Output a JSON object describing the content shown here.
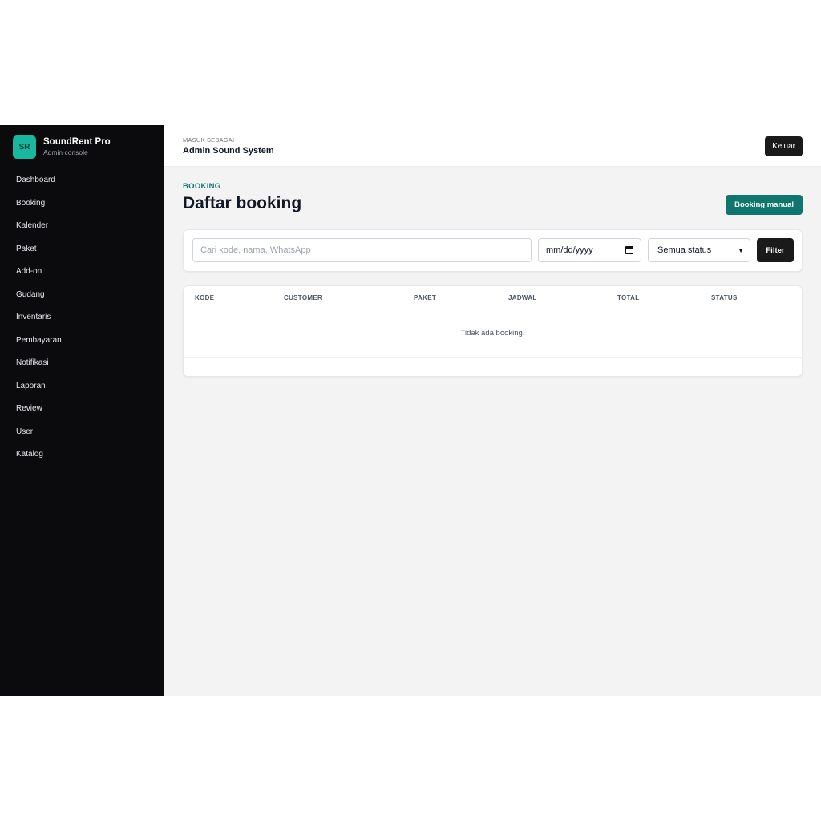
{
  "sidebar": {
    "logo_text": "SR",
    "brand_name": "SoundRent Pro",
    "brand_sub": "Admin console",
    "items": [
      {
        "label": "Dashboard"
      },
      {
        "label": "Booking"
      },
      {
        "label": "Kalender"
      },
      {
        "label": "Paket"
      },
      {
        "label": "Add-on"
      },
      {
        "label": "Gudang"
      },
      {
        "label": "Inventaris"
      },
      {
        "label": "Pembayaran"
      },
      {
        "label": "Notifikasi"
      },
      {
        "label": "Laporan"
      },
      {
        "label": "Review"
      },
      {
        "label": "User"
      },
      {
        "label": "Katalog"
      }
    ]
  },
  "header": {
    "signin_label": "MASUK SEBAGAI",
    "user_name": "Admin Sound System",
    "logout_label": "Keluar"
  },
  "page": {
    "section": "BOOKING",
    "title": "Daftar booking",
    "manual_button": "Booking manual"
  },
  "filters": {
    "search_placeholder": "Cari kode, nama, WhatsApp",
    "date_placeholder": "mm/dd/yyyy",
    "status_selected": "Semua status",
    "filter_button": "Filter"
  },
  "table": {
    "columns": [
      "KODE",
      "CUSTOMER",
      "PAKET",
      "JADWAL",
      "TOTAL",
      "STATUS"
    ],
    "empty_text": "Tidak ada booking."
  },
  "colors": {
    "accent": "#0f766e",
    "logo": "#19b7a0",
    "sidebar_bg": "#0b0b0d"
  }
}
